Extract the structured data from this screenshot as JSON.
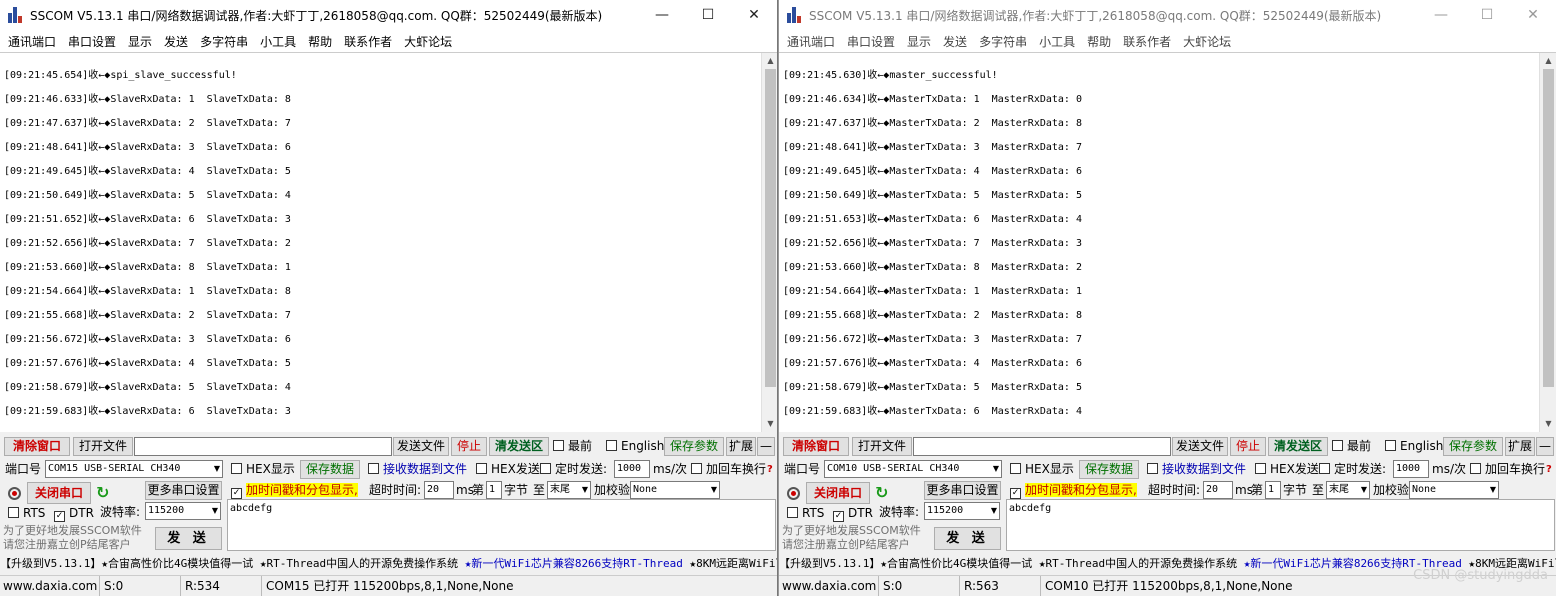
{
  "windows": [
    {
      "id": "left",
      "title": "SSCOM V5.13.1 串口/网络数据调试器,作者:大虾丁丁,2618058@qq.com. QQ群：52502449(最新版本)",
      "menu": [
        "通讯端口",
        "串口设置",
        "显示",
        "发送",
        "多字符串",
        "小工具",
        "帮助",
        "联系作者",
        "大虾论坛"
      ],
      "log": [
        "[09:21:45.654]收←◆spi_slave_successful!",
        "[09:21:46.633]收←◆SlaveRxData: 1  SlaveTxData: 8",
        "[09:21:47.637]收←◆SlaveRxData: 2  SlaveTxData: 7",
        "[09:21:48.641]收←◆SlaveRxData: 3  SlaveTxData: 6",
        "[09:21:49.645]收←◆SlaveRxData: 4  SlaveTxData: 5",
        "[09:21:50.649]收←◆SlaveRxData: 5  SlaveTxData: 4",
        "[09:21:51.652]收←◆SlaveRxData: 6  SlaveTxData: 3",
        "[09:21:52.656]收←◆SlaveRxData: 7  SlaveTxData: 2",
        "[09:21:53.660]收←◆SlaveRxData: 8  SlaveTxData: 1",
        "[09:21:54.664]收←◆SlaveRxData: 1  SlaveTxData: 8",
        "[09:21:55.668]收←◆SlaveRxData: 2  SlaveTxData: 7",
        "[09:21:56.672]收←◆SlaveRxData: 3  SlaveTxData: 6",
        "[09:21:57.676]收←◆SlaveRxData: 4  SlaveTxData: 5",
        "[09:21:58.679]收←◆SlaveRxData: 5  SlaveTxData: 4",
        "[09:21:59.683]收←◆SlaveRxData: 6  SlaveTxData: 3"
      ],
      "port": "COM15 USB-SERIAL CH340",
      "status_rx": "R:534",
      "status_port": "COM15 已打开  115200bps,8,1,None,None"
    },
    {
      "id": "right",
      "title": "SSCOM V5.13.1 串口/网络数据调试器,作者:大虾丁丁,2618058@qq.com. QQ群：52502449(最新版本)",
      "menu": [
        "通讯端口",
        "串口设置",
        "显示",
        "发送",
        "多字符串",
        "小工具",
        "帮助",
        "联系作者",
        "大虾论坛"
      ],
      "log": [
        "[09:21:45.630]收←◆master_successful!",
        "[09:21:46.634]收←◆MasterTxData: 1  MasterRxData: 0",
        "[09:21:47.637]收←◆MasterTxData: 2  MasterRxData: 8",
        "[09:21:48.641]收←◆MasterTxData: 3  MasterRxData: 7",
        "[09:21:49.645]收←◆MasterTxData: 4  MasterRxData: 6",
        "[09:21:50.649]收←◆MasterTxData: 5  MasterRxData: 5",
        "[09:21:51.653]收←◆MasterTxData: 6  MasterRxData: 4",
        "[09:21:52.656]收←◆MasterTxData: 7  MasterRxData: 3",
        "[09:21:53.660]收←◆MasterTxData: 8  MasterRxData: 2",
        "[09:21:54.664]收←◆MasterTxData: 1  MasterRxData: 1",
        "[09:21:55.668]收←◆MasterTxData: 2  MasterRxData: 8",
        "[09:21:56.672]收←◆MasterTxData: 3  MasterRxData: 7",
        "[09:21:57.676]收←◆MasterTxData: 4  MasterRxData: 6",
        "[09:21:58.679]收←◆MasterTxData: 5  MasterRxData: 5",
        "[09:21:59.683]收←◆MasterTxData: 6  MasterRxData: 4"
      ],
      "port": "COM10 USB-SERIAL CH340",
      "status_rx": "R:563",
      "status_port": "COM10 已打开  115200bps,8,1,None,None"
    }
  ],
  "common": {
    "btn_clear": "清除窗口",
    "btn_open_file": "打开文件",
    "btn_send_file": "发送文件",
    "btn_stop": "停止",
    "btn_clear_send": "清发送区",
    "chk_top": "最前",
    "chk_english": "English",
    "btn_save_params": "保存参数",
    "btn_expand": "扩展",
    "btn_collapse": "—",
    "lbl_port": "端口号",
    "chk_hex_display": "HEX显示",
    "btn_save_data": "保存数据",
    "chk_recv_to_file": "接收数据到文件",
    "chk_hex_send": "HEX发送",
    "chk_timed_send": "定时发送:",
    "timed_interval": "1000",
    "lbl_ms_per": "ms/次",
    "chk_add_crlf": "加回车换行",
    "help_mark": "?",
    "btn_close_port": "关闭串口",
    "btn_more_settings": "更多串口设置",
    "chk_timestamp": "加时间戳和分包显示,",
    "lbl_timeout": "超时时间:",
    "timeout_value": "20",
    "lbl_ms": "ms",
    "lbl_di": "第",
    "byte_index": "1",
    "lbl_byte": "字节",
    "lbl_to": "至",
    "end_select": "末尾",
    "lbl_checksum": "加校验",
    "checksum_select": "None",
    "chk_rts": "RTS",
    "chk_dtr": "DTR",
    "lbl_baud": "波特率:",
    "baud_value": "115200",
    "send_text": "abcdefg",
    "btn_send": "发 送",
    "promo_line1": "为了更好地发展SSCOM软件",
    "promo_line2": "请您注册嘉立创P结尾客户",
    "ticker_a": "【升级到V5.13.1】★合宙高性价比4G模块值得一试 ★RT-Thread中国人的开源免费操作系统 ",
    "ticker_b": "★新一代WiFi芯片兼容8266支持RT-Thread",
    "ticker_c": " ★8KM远距离WiFi可自组网",
    "status_site": "www.daxia.com",
    "status_tx": "S:0",
    "watermark": "CSDN @studyingdda",
    "check_mark": "✓"
  }
}
